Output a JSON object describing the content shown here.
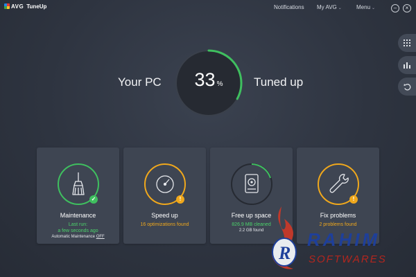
{
  "app": {
    "brand": "AVG",
    "name": "TuneUp"
  },
  "nav": {
    "notifications": "Notifications",
    "my_avg": "My AVG",
    "menu": "Menu"
  },
  "window_controls": {
    "minimize": "–",
    "close": "×"
  },
  "hero": {
    "left": "Your PC",
    "right": "Tuned up",
    "percent": "33",
    "unit": "%",
    "progress": 0.33
  },
  "cards": [
    {
      "title": "Maintenance",
      "lines": [
        "Last run:",
        "a few seconds ago"
      ],
      "auto_label": "Automatic Maintenance",
      "auto_value": "OFF",
      "status": "ok",
      "ring_color": "#3fbf5f",
      "icon": "broom-icon"
    },
    {
      "title": "Speed up",
      "lines": [
        "16 optimizations found"
      ],
      "status": "warning",
      "ring_color": "#f0a81c",
      "icon": "speedometer-icon"
    },
    {
      "title": "Free up space",
      "lines": [
        "826.9 MB cleaned",
        "2.2 GB found"
      ],
      "status": "none",
      "ring_color": "#3fbf5f",
      "icon": "hard-drive-icon"
    },
    {
      "title": "Fix problems",
      "lines": [
        "2 problems found"
      ],
      "status": "warning",
      "ring_color": "#f0a81c",
      "icon": "wrench-icon"
    }
  ],
  "side_tools": [
    "grid-icon",
    "bar-chart-icon",
    "undo-icon"
  ],
  "watermark": {
    "top": "RAHIM",
    "bottom": "SOFTWARES"
  },
  "colors": {
    "green": "#3fbf5f",
    "orange": "#f0a81c",
    "card_bg": "#3e4552",
    "text_green": "#4cd36b",
    "text_orange": "#f0a81c"
  }
}
